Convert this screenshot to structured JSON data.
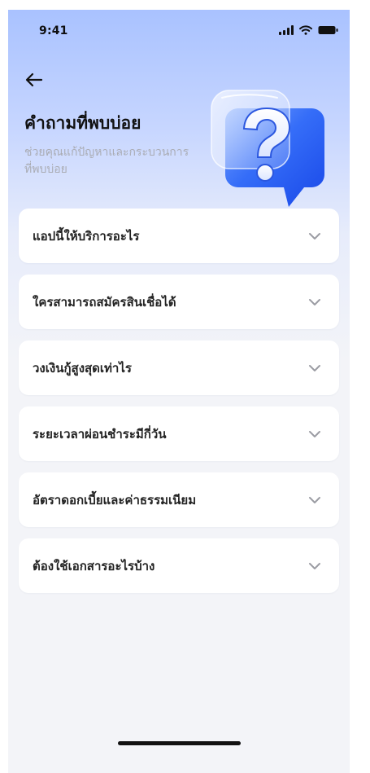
{
  "status_bar": {
    "time": "9:41",
    "icons": [
      "cellular-signal-icon",
      "wifi-icon",
      "battery-icon"
    ]
  },
  "header": {
    "back_icon": "arrow-left-icon",
    "title": "คำถามที่พบบ่อย",
    "subtitle": "ช่วยคุณแก้ปัญหาและกระบวนการที่พบบ่อย",
    "illustration": "question-bubble-icon"
  },
  "faq": {
    "items": [
      {
        "question": "แอปนี้ให้บริการอะไร",
        "icon": "chevron-down-icon"
      },
      {
        "question": "ใครสามารถสมัครสินเชื่อได้",
        "icon": "chevron-down-icon"
      },
      {
        "question": "วงเงินกู้สูงสุดเท่าไร",
        "icon": "chevron-down-icon"
      },
      {
        "question": "ระยะเวลาผ่อนชำระมีกี่วัน",
        "icon": "chevron-down-icon"
      },
      {
        "question": "อัตราดอกเบี้ยและค่าธรรมเนียม",
        "icon": "chevron-down-icon"
      },
      {
        "question": "ต้องใช้เอกสารอะไรบ้าง",
        "icon": "chevron-down-icon"
      }
    ]
  },
  "colors": {
    "hero_gradient_top": "#a9c2ff",
    "background": "#f3f4f8",
    "card": "#ffffff",
    "title": "#111111",
    "subtitle": "#aaacb4",
    "question_text": "#232323",
    "chevron": "#9b9ca3",
    "illustration_blue": "#2f62f6"
  }
}
